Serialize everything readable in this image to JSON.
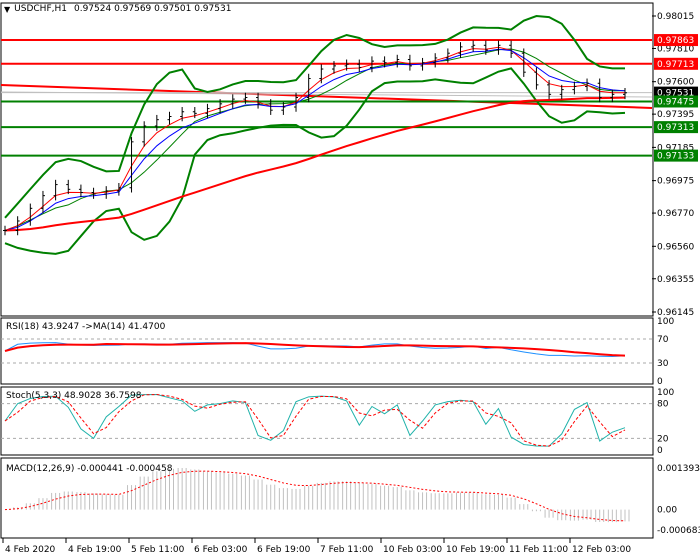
{
  "header": {
    "symbol": "USDCHF,H1",
    "ohlc": "0.97524 0.97569 0.97501 0.97531"
  },
  "chart_data": {
    "type": "line",
    "title": "USDCHF,H1",
    "price_axis": {
      "ticks": [
        "0.98015",
        "0.97810",
        "0.97600",
        "0.97395",
        "0.97185",
        "0.96975",
        "0.96770",
        "0.96560",
        "0.96355",
        "0.96145"
      ],
      "range": [
        0.96145,
        0.98015
      ]
    },
    "levels": [
      {
        "price": 0.97863,
        "label": "0.97863",
        "color": "#ff0000"
      },
      {
        "price": 0.97713,
        "label": "0.97713",
        "color": "#ff0000"
      },
      {
        "price": 0.97531,
        "label": "0.97531",
        "color": "#000000",
        "current": true
      },
      {
        "price": 0.97475,
        "label": "0.97475",
        "color": "#008000"
      },
      {
        "price": 0.97313,
        "label": "0.97313",
        "color": "#008000"
      },
      {
        "price": 0.97133,
        "label": "0.97133",
        "color": "#008000"
      }
    ],
    "time_axis": [
      "4 Feb 2020",
      "4 Feb 19:00",
      "5 Feb 11:00",
      "6 Feb 03:00",
      "6 Feb 19:00",
      "7 Feb 11:00",
      "10 Feb 03:00",
      "10 Feb 19:00",
      "11 Feb 11:00",
      "12 Feb 03:00"
    ],
    "closes": [
      0.9666,
      0.9672,
      0.968,
      0.9688,
      0.9695,
      0.9692,
      0.969,
      0.9689,
      0.9691,
      0.9693,
      0.9722,
      0.9732,
      0.9736,
      0.9738,
      0.9741,
      0.974,
      0.9743,
      0.9746,
      0.9749,
      0.975,
      0.9746,
      0.9742,
      0.9744,
      0.975,
      0.9762,
      0.9768,
      0.977,
      0.9771,
      0.9769,
      0.9773,
      0.9772,
      0.9774,
      0.977,
      0.9772,
      0.9775,
      0.9778,
      0.9782,
      0.9783,
      0.978,
      0.9783,
      0.9778,
      0.9766,
      0.9758,
      0.9752,
      0.9755,
      0.9757,
      0.9759,
      0.975,
      0.9752,
      0.9753
    ],
    "rsi": {
      "label": "RSI(18) 43.9247  ->MA(14) 41.4700",
      "ticks": [
        "100",
        "70",
        "30",
        "0"
      ]
    },
    "stoch": {
      "label": "Stoch(5,3,3) 48.9028 36.7598",
      "ticks": [
        "100",
        "80",
        "20",
        "0"
      ]
    },
    "macd": {
      "label": "MACD(12,26,9) -0.000441 -0.000458",
      "ticks": [
        "0.001393",
        "0.00",
        "-0.000683"
      ]
    },
    "colors": {
      "bands": "#008000",
      "ma_red": "#ff0000",
      "ma_blue": "#0000ff",
      "rsi": "#1e90ff",
      "stoch_main": "#20b2aa",
      "signal": "#ff0000",
      "hist": "#c0c0c0"
    }
  }
}
